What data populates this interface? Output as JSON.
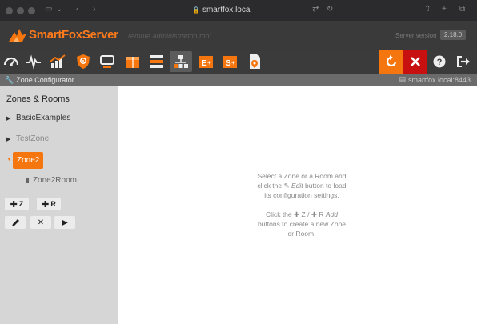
{
  "browser": {
    "url": "smartfox.local"
  },
  "header": {
    "brand": "SmartFoxServer",
    "subtitle": "remote administration tool",
    "version_label": "Server version",
    "version": "2.18.0"
  },
  "toolbar": {
    "items": [
      {
        "name": "dashboard-icon"
      },
      {
        "name": "monitor-icon"
      },
      {
        "name": "analytics-icon"
      },
      {
        "name": "server-config-icon"
      },
      {
        "name": "console-icon"
      },
      {
        "name": "admin-box-icon"
      },
      {
        "name": "server-icon"
      },
      {
        "name": "zone-configurator-icon"
      },
      {
        "name": "extension-deploy-icon",
        "label": "E"
      },
      {
        "name": "server-deploy-icon",
        "label": "S"
      },
      {
        "name": "file-icon"
      }
    ],
    "restart": "restart-icon",
    "halt": "close-icon",
    "help": "help-icon",
    "logout": "logout-icon"
  },
  "section": {
    "title": "Zone Configurator",
    "server": "smartfox.local:8443"
  },
  "sidebar": {
    "title": "Zones & Rooms",
    "zones": [
      "BasicExamples",
      "TestZone"
    ],
    "selected_zone": "Zone2",
    "room": "Zone2Room",
    "buttons": {
      "add_zone": "Z",
      "add_room": "R"
    }
  },
  "main": {
    "hint1": {
      "line1": "Select a Zone or a Room and",
      "line2a": "click the",
      "line2b": "Edit",
      "line2c": "button to load",
      "line3": "its configuration settings."
    },
    "hint2": {
      "line1a": "Click the",
      "line1b": "Z /",
      "line1c": "R",
      "line1d": "Add",
      "line2": "buttons to create a new Zone",
      "line3": "or Room."
    }
  },
  "colors": {
    "accent": "#f5760f",
    "halt": "#c81010"
  }
}
